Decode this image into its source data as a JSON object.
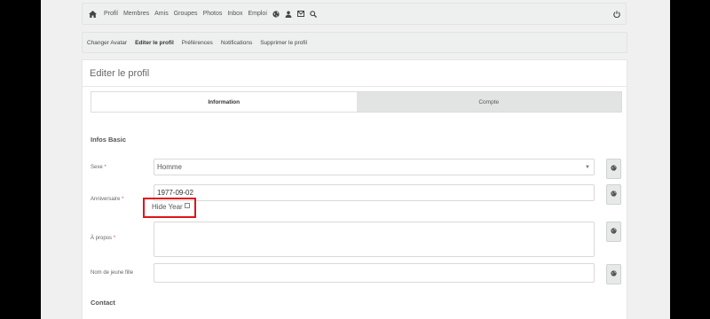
{
  "topnav": {
    "items": [
      "Profil",
      "Membres",
      "Amis",
      "Groupes",
      "Photos",
      "Inbox",
      "Emploi"
    ],
    "icons": [
      "globe-icon",
      "user-add-icon",
      "mail-icon",
      "search-icon"
    ]
  },
  "subnav": {
    "items": [
      "Changer Avatar",
      "Editer le profil",
      "Préférences",
      "Notifications",
      "Supprimer le profil"
    ],
    "active": "Editer le profil"
  },
  "panel": {
    "title": "Editer le profil",
    "tabs": [
      {
        "label": "Information",
        "active": true
      },
      {
        "label": "Compte",
        "active": false
      }
    ]
  },
  "sections": {
    "basic": "Infos Basic",
    "contact": "Contact"
  },
  "fields": {
    "sexe": {
      "label": "Sexe",
      "required": "*",
      "value": "Homme"
    },
    "anniversaire": {
      "label": "Anniversaire",
      "required": "*",
      "value": "1977-09-02",
      "hide_year_label": "Hide Year"
    },
    "apropos": {
      "label": "À propos",
      "required": "*",
      "value": ""
    },
    "nom_jeune_fille": {
      "label": "Nom de jeune fille",
      "value": ""
    }
  },
  "colors": {
    "highlight_border": "#e0141b",
    "required": "#d9534f"
  }
}
